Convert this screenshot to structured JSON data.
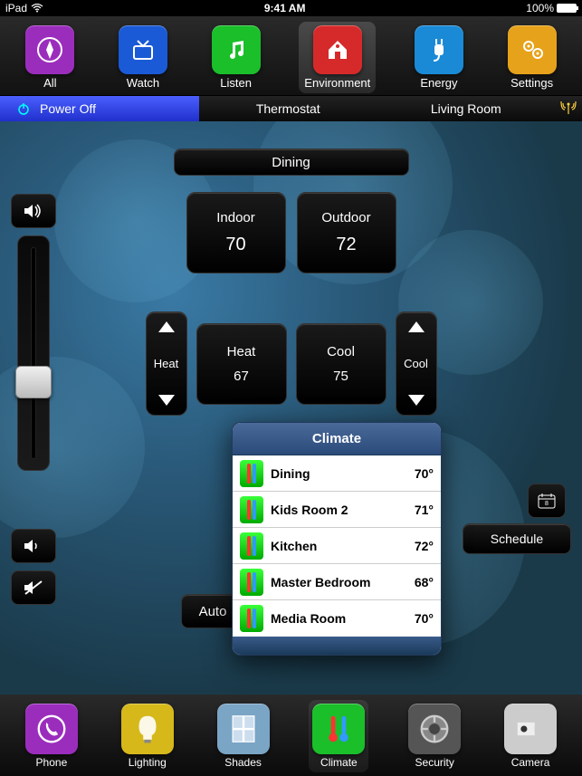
{
  "status": {
    "device": "iPad",
    "time": "9:41 AM",
    "battery": "100%"
  },
  "top_nav": {
    "items": [
      {
        "label": "All",
        "icon": "compass-icon",
        "color": "#9b2dbd"
      },
      {
        "label": "Watch",
        "icon": "tv-icon",
        "color": "#1a5ad6"
      },
      {
        "label": "Listen",
        "icon": "music-icon",
        "color": "#1abf2a"
      },
      {
        "label": "Environment",
        "icon": "house-icon",
        "color": "#d62a2a",
        "selected": true
      },
      {
        "label": "Energy",
        "icon": "plug-icon",
        "color": "#1a8ad6"
      },
      {
        "label": "Settings",
        "icon": "gears-icon",
        "color": "#e6a21a"
      }
    ]
  },
  "sub_bar": {
    "power": "Power Off",
    "center": "Thermostat",
    "room": "Living Room"
  },
  "room_label": "Dining",
  "temps": {
    "indoor": {
      "label": "Indoor",
      "value": "70"
    },
    "outdoor": {
      "label": "Outdoor",
      "value": "72"
    }
  },
  "setpoints": {
    "heat": {
      "stepper_label": "Heat",
      "label": "Heat",
      "value": "67"
    },
    "cool": {
      "stepper_label": "Cool",
      "label": "Cool",
      "value": "75"
    }
  },
  "auto_label": "Auto",
  "schedule_label": "Schedule",
  "popover": {
    "title": "Climate",
    "rows": [
      {
        "name": "Dining",
        "temp": "70°"
      },
      {
        "name": "Kids Room 2",
        "temp": "71°"
      },
      {
        "name": "Kitchen",
        "temp": "72°"
      },
      {
        "name": "Master Bedroom",
        "temp": "68°"
      },
      {
        "name": "Media Room",
        "temp": "70°"
      }
    ]
  },
  "bottom_nav": {
    "items": [
      {
        "label": "Phone",
        "icon": "phone-icon",
        "color": "#9b2dbd"
      },
      {
        "label": "Lighting",
        "icon": "bulb-icon",
        "color": "#d6b81a"
      },
      {
        "label": "Shades",
        "icon": "window-icon",
        "color": "#7aa5c5"
      },
      {
        "label": "Climate",
        "icon": "thermometer-icon",
        "color": "#1abf2a",
        "selected": true
      },
      {
        "label": "Security",
        "icon": "vault-icon",
        "color": "#555"
      },
      {
        "label": "Camera",
        "icon": "camera-icon",
        "color": "#ccc"
      }
    ]
  }
}
